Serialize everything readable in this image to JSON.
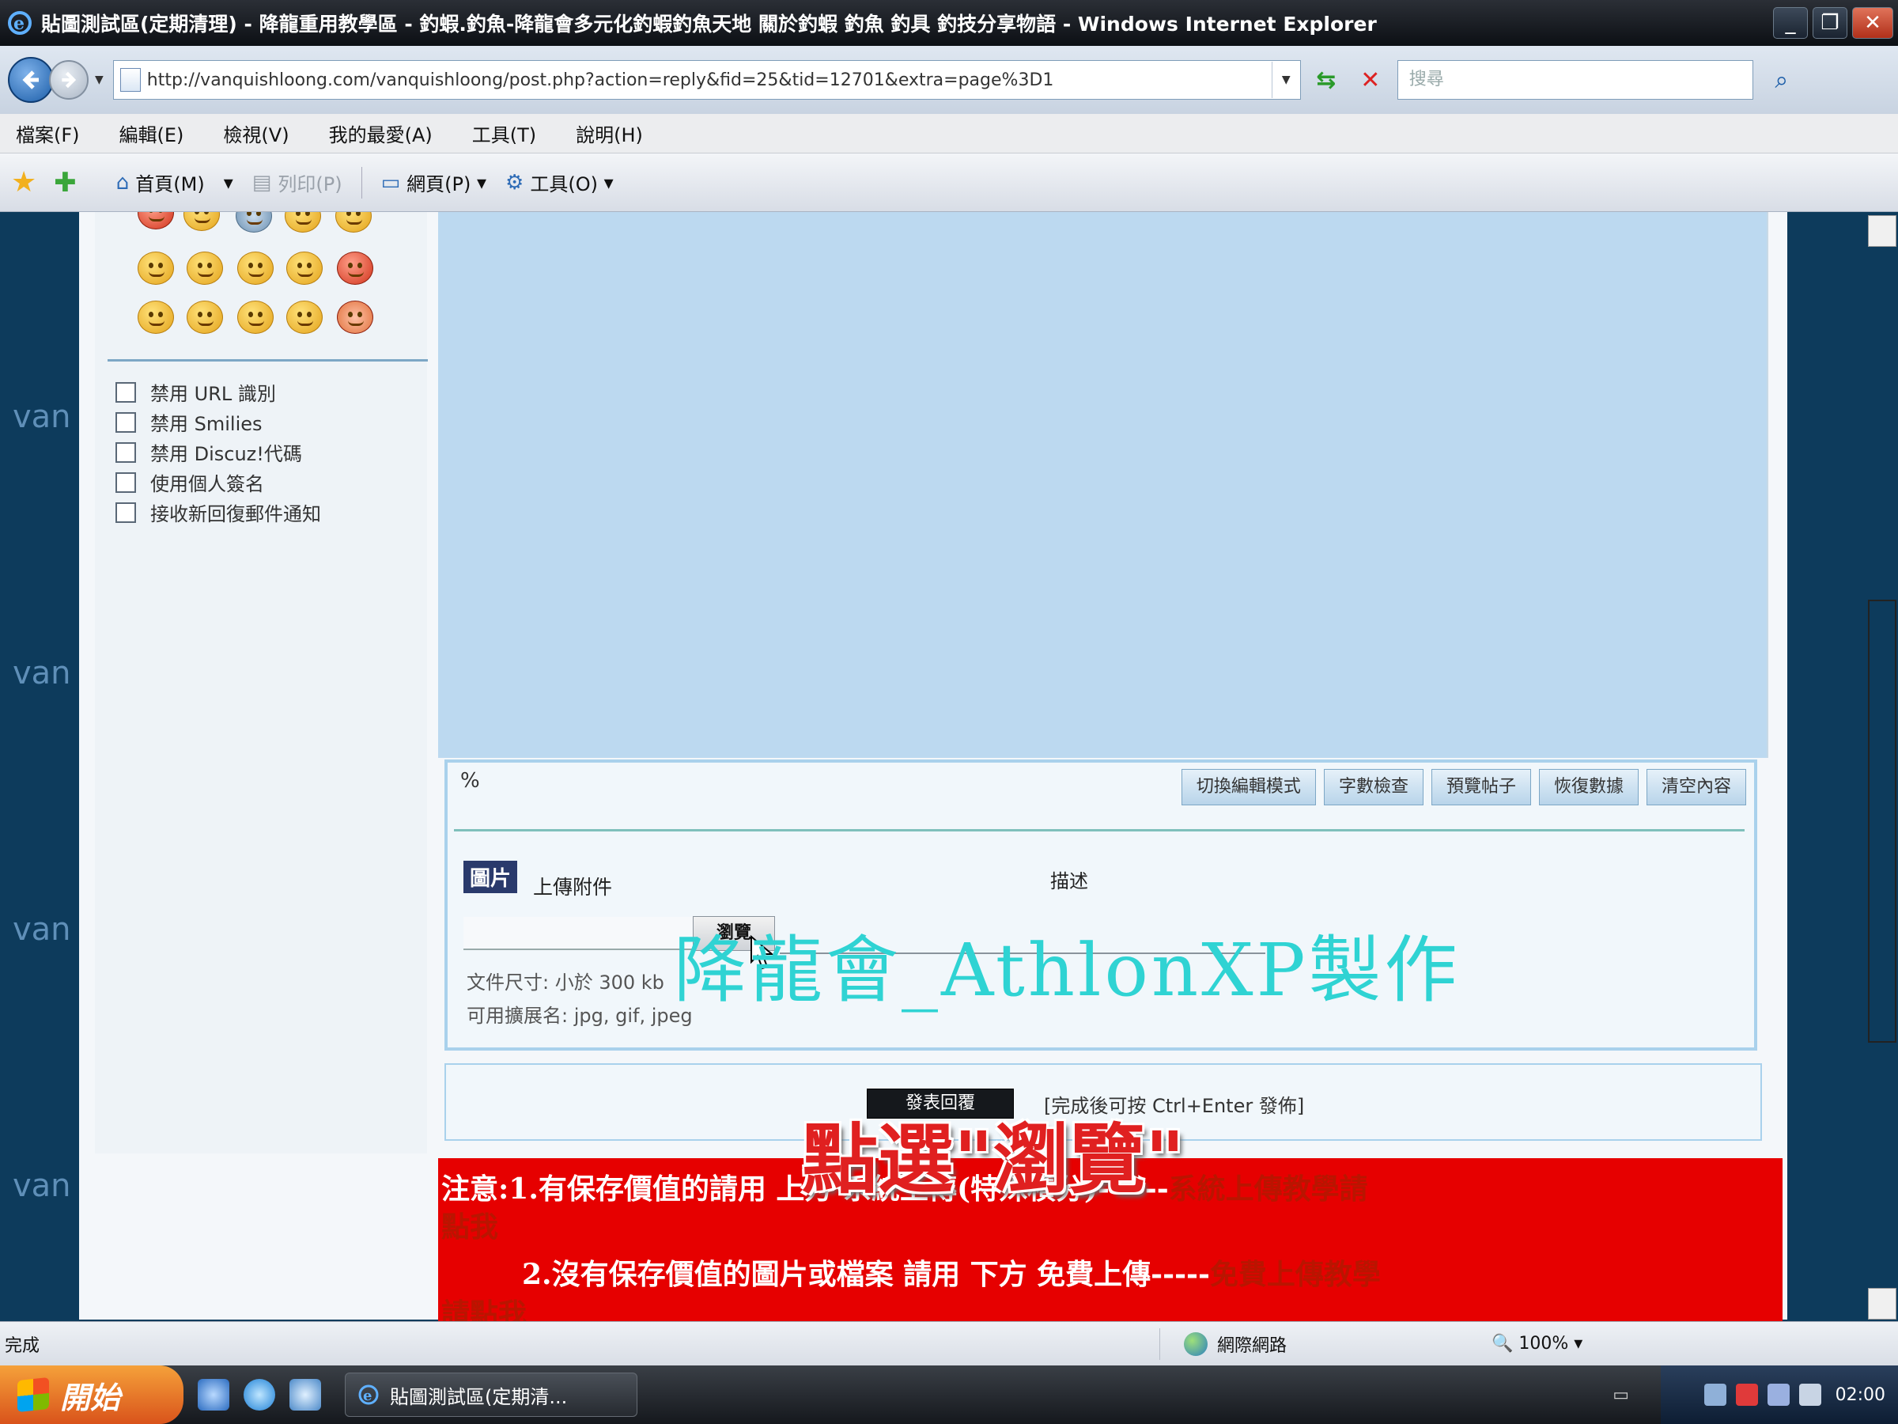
{
  "window": {
    "title": "貼圖測試區(定期清理) - 降龍重用教學區 - 釣蝦.釣魚-降龍會多元化釣蝦釣魚天地 關於釣蝦 釣魚 釣具 釣技分享物語 - Windows Internet Explorer",
    "minimize": "_",
    "restore": "❐",
    "close": "✕"
  },
  "address": {
    "url": "http://vanquishloong.com/vanquishloong/post.php?action=reply&fid=25&tid=12701&extra=page%3D1",
    "search_placeholder": "搜尋"
  },
  "menu": [
    "檔案(F)",
    "編輯(E)",
    "檢視(V)",
    "我的最愛(A)",
    "工具(T)",
    "說明(H)"
  ],
  "commandbar": {
    "home": "首頁(M)",
    "print": "列印(P)",
    "page": "網頁(P)",
    "tools": "工具(O)"
  },
  "side_watermark": "van",
  "options": [
    "禁用 URL 識別",
    "禁用 Smilies",
    "禁用 Discuz!代碼",
    "使用個人簽名",
    "接收新回復郵件通知"
  ],
  "editor": {
    "percent": "%",
    "buttons": [
      "切換編輯模式",
      "字數檢查",
      "預覽帖子",
      "恢復數據",
      "清空內容"
    ]
  },
  "attachment": {
    "tab": "圖片",
    "label": "上傳附件",
    "desc_label": "描述",
    "browse": "瀏覽",
    "size": "文件尺寸: 小於 300 kb",
    "ext": "可用擴展名: jpg, gif, jpeg"
  },
  "submit": {
    "button": "發表回覆",
    "hint": "[完成後可按 Ctrl+Enter 發佈]"
  },
  "notice": {
    "line1": "注意:1.有保存價值的請用 上方 系統上傳(特殊積分)------",
    "line1_link": "系統上傳教學請",
    "line2": "點我",
    "line3": "2.沒有保存價值的圖片或檔案 請用 下方 免費上傳-----",
    "line3_link": "免費上傳教學",
    "line4": "請點我"
  },
  "overlay": {
    "watermark": "降龍會_AthlonXP製作",
    "annotation": "點選\"瀏覽\""
  },
  "status": {
    "text": "完成",
    "zone": "網際網路",
    "zoom": "100%"
  },
  "taskbar": {
    "start": "開始",
    "task": "貼圖測試區(定期清...",
    "clock": "02:00"
  },
  "colors": {
    "side_bg": "#0d3b5c",
    "editor_bg": "#bcd9f0",
    "notice_bg": "#e60000",
    "watermark": "#2fd3d3",
    "annotation": "#e02020"
  }
}
